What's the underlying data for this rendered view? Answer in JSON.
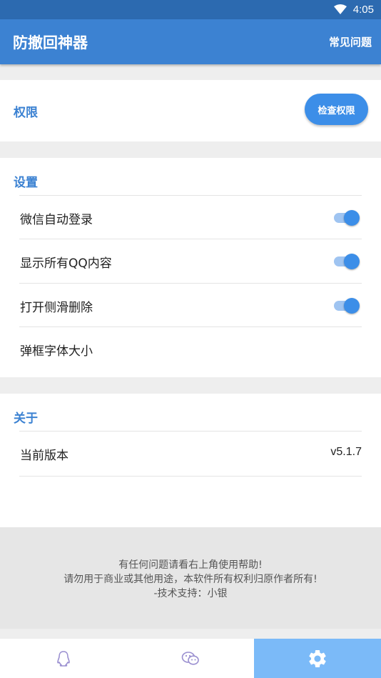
{
  "status_bar": {
    "time": "4:05",
    "wifi_icon": "wifi-icon"
  },
  "app_bar": {
    "title": "防撤回神器",
    "faq_label": "常见问题"
  },
  "permission": {
    "label": "权限",
    "button_label": "检查权限"
  },
  "settings": {
    "title": "设置",
    "items": [
      {
        "label": "微信自动登录",
        "toggle": true
      },
      {
        "label": "显示所有QQ内容",
        "toggle": true
      },
      {
        "label": "打开侧滑删除",
        "toggle": true
      },
      {
        "label": "弹框字体大小"
      }
    ]
  },
  "about": {
    "title": "关于",
    "version_label": "当前版本",
    "version_value": "v5.1.7"
  },
  "footer": {
    "line1": "有任何问题请看右上角使用帮助!",
    "line2": "请勿用于商业或其他用途，本软件所有权利归原作者所有!",
    "line3": "-技术支持：小银"
  },
  "tabs": [
    {
      "icon": "qq-penguin-icon",
      "active": false
    },
    {
      "icon": "wechat-icon",
      "active": false
    },
    {
      "icon": "gear-icon",
      "active": true
    }
  ],
  "colors": {
    "status_bar": "#2c6ab0",
    "app_bar": "#3c82d2",
    "accent": "#3c8ee8",
    "active_tab": "#7bbaf8"
  }
}
